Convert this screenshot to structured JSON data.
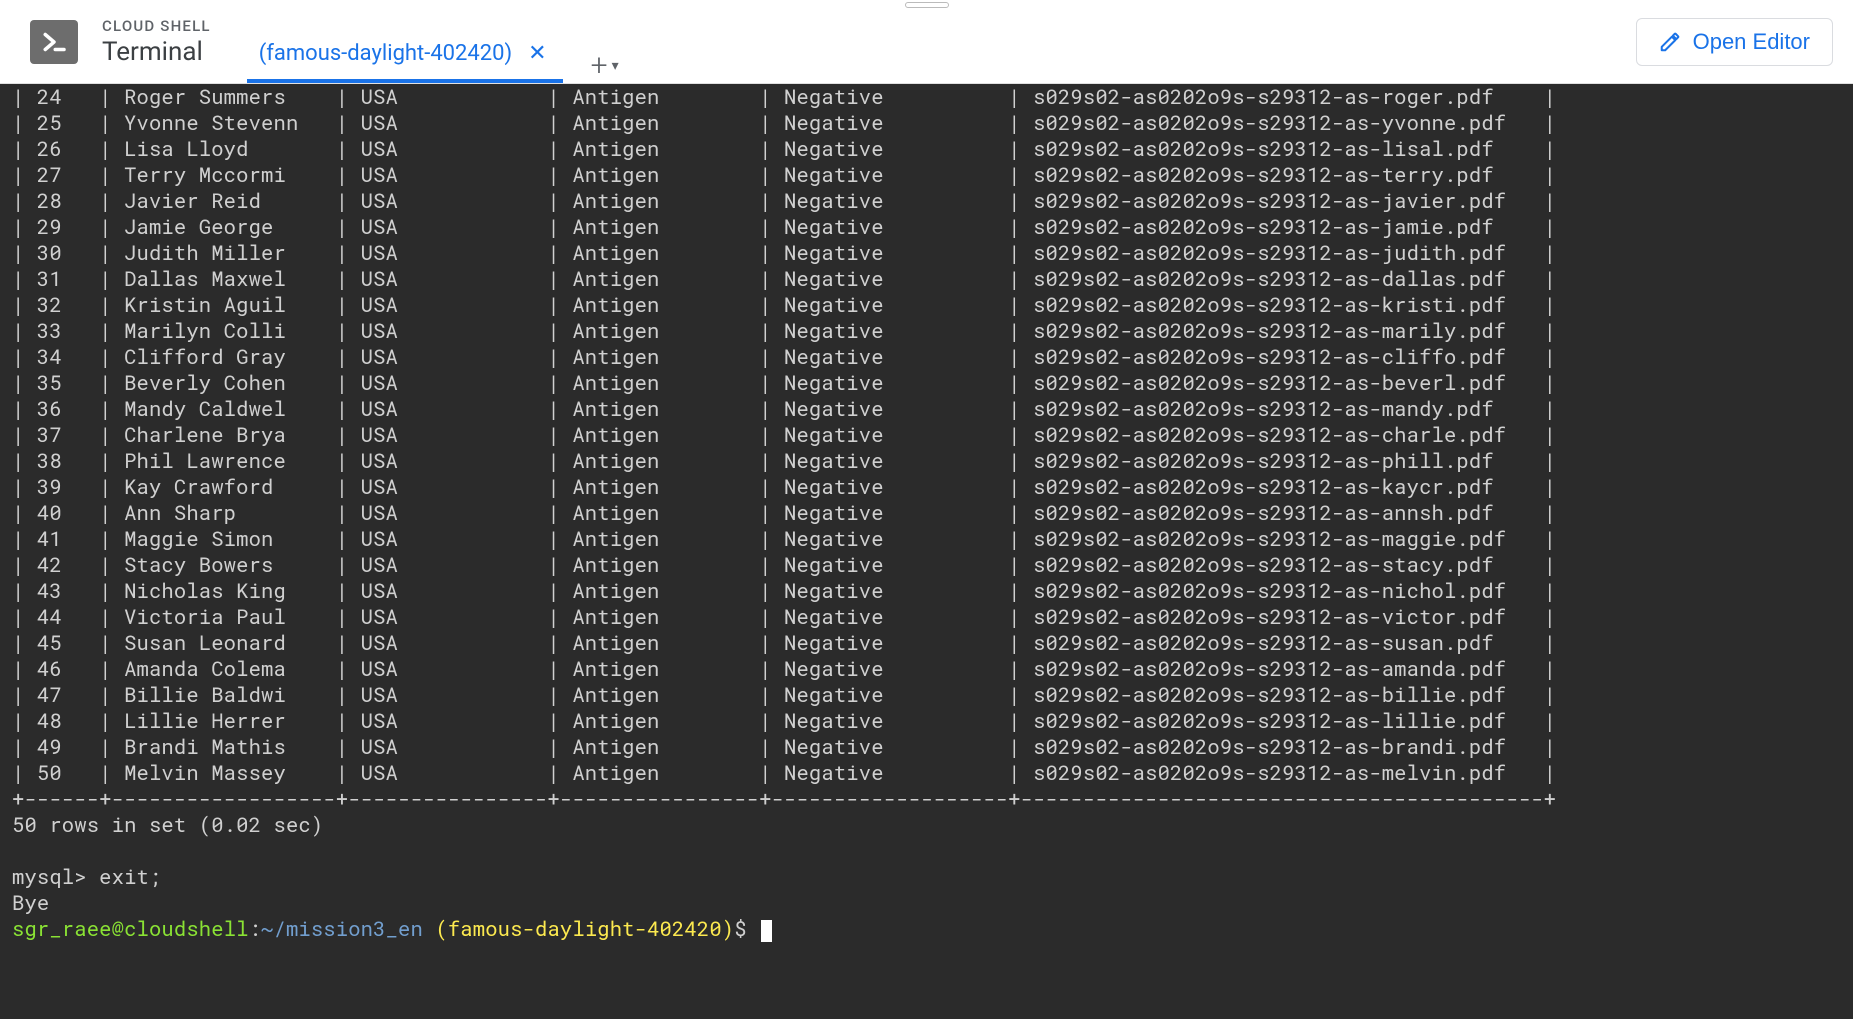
{
  "header": {
    "small_title": "CLOUD SHELL",
    "large_title": "Terminal",
    "active_tab_label": "(famous-daylight-402420)",
    "open_editor_label": "Open Editor"
  },
  "table": {
    "rows": [
      {
        "id": "24",
        "name": "Roger Summers",
        "country": "USA",
        "test": "Antigen",
        "result": "Negative",
        "file": "s029s02-as0202o9s-s29312-as-roger.pdf"
      },
      {
        "id": "25",
        "name": "Yvonne Stevenn",
        "country": "USA",
        "test": "Antigen",
        "result": "Negative",
        "file": "s029s02-as0202o9s-s29312-as-yvonne.pdf"
      },
      {
        "id": "26",
        "name": "Lisa Lloyd",
        "country": "USA",
        "test": "Antigen",
        "result": "Negative",
        "file": "s029s02-as0202o9s-s29312-as-lisal.pdf"
      },
      {
        "id": "27",
        "name": "Terry Mccormi",
        "country": "USA",
        "test": "Antigen",
        "result": "Negative",
        "file": "s029s02-as0202o9s-s29312-as-terry.pdf"
      },
      {
        "id": "28",
        "name": "Javier Reid",
        "country": "USA",
        "test": "Antigen",
        "result": "Negative",
        "file": "s029s02-as0202o9s-s29312-as-javier.pdf"
      },
      {
        "id": "29",
        "name": "Jamie George",
        "country": "USA",
        "test": "Antigen",
        "result": "Negative",
        "file": "s029s02-as0202o9s-s29312-as-jamie.pdf"
      },
      {
        "id": "30",
        "name": "Judith Miller",
        "country": "USA",
        "test": "Antigen",
        "result": "Negative",
        "file": "s029s02-as0202o9s-s29312-as-judith.pdf"
      },
      {
        "id": "31",
        "name": "Dallas Maxwel",
        "country": "USA",
        "test": "Antigen",
        "result": "Negative",
        "file": "s029s02-as0202o9s-s29312-as-dallas.pdf"
      },
      {
        "id": "32",
        "name": "Kristin Aguil",
        "country": "USA",
        "test": "Antigen",
        "result": "Negative",
        "file": "s029s02-as0202o9s-s29312-as-kristi.pdf"
      },
      {
        "id": "33",
        "name": "Marilyn Colli",
        "country": "USA",
        "test": "Antigen",
        "result": "Negative",
        "file": "s029s02-as0202o9s-s29312-as-marily.pdf"
      },
      {
        "id": "34",
        "name": "Clifford Gray",
        "country": "USA",
        "test": "Antigen",
        "result": "Negative",
        "file": "s029s02-as0202o9s-s29312-as-cliffo.pdf"
      },
      {
        "id": "35",
        "name": "Beverly Cohen",
        "country": "USA",
        "test": "Antigen",
        "result": "Negative",
        "file": "s029s02-as0202o9s-s29312-as-beverl.pdf"
      },
      {
        "id": "36",
        "name": "Mandy Caldwel",
        "country": "USA",
        "test": "Antigen",
        "result": "Negative",
        "file": "s029s02-as0202o9s-s29312-as-mandy.pdf"
      },
      {
        "id": "37",
        "name": "Charlene Brya",
        "country": "USA",
        "test": "Antigen",
        "result": "Negative",
        "file": "s029s02-as0202o9s-s29312-as-charle.pdf"
      },
      {
        "id": "38",
        "name": "Phil Lawrence",
        "country": "USA",
        "test": "Antigen",
        "result": "Negative",
        "file": "s029s02-as0202o9s-s29312-as-phill.pdf"
      },
      {
        "id": "39",
        "name": "Kay Crawford",
        "country": "USA",
        "test": "Antigen",
        "result": "Negative",
        "file": "s029s02-as0202o9s-s29312-as-kaycr.pdf"
      },
      {
        "id": "40",
        "name": "Ann Sharp",
        "country": "USA",
        "test": "Antigen",
        "result": "Negative",
        "file": "s029s02-as0202o9s-s29312-as-annsh.pdf"
      },
      {
        "id": "41",
        "name": "Maggie Simon",
        "country": "USA",
        "test": "Antigen",
        "result": "Negative",
        "file": "s029s02-as0202o9s-s29312-as-maggie.pdf"
      },
      {
        "id": "42",
        "name": "Stacy Bowers",
        "country": "USA",
        "test": "Antigen",
        "result": "Negative",
        "file": "s029s02-as0202o9s-s29312-as-stacy.pdf"
      },
      {
        "id": "43",
        "name": "Nicholas King",
        "country": "USA",
        "test": "Antigen",
        "result": "Negative",
        "file": "s029s02-as0202o9s-s29312-as-nichol.pdf"
      },
      {
        "id": "44",
        "name": "Victoria Paul",
        "country": "USA",
        "test": "Antigen",
        "result": "Negative",
        "file": "s029s02-as0202o9s-s29312-as-victor.pdf"
      },
      {
        "id": "45",
        "name": "Susan Leonard",
        "country": "USA",
        "test": "Antigen",
        "result": "Negative",
        "file": "s029s02-as0202o9s-s29312-as-susan.pdf"
      },
      {
        "id": "46",
        "name": "Amanda Colema",
        "country": "USA",
        "test": "Antigen",
        "result": "Negative",
        "file": "s029s02-as0202o9s-s29312-as-amanda.pdf"
      },
      {
        "id": "47",
        "name": "Billie Baldwi",
        "country": "USA",
        "test": "Antigen",
        "result": "Negative",
        "file": "s029s02-as0202o9s-s29312-as-billie.pdf"
      },
      {
        "id": "48",
        "name": "Lillie Herrer",
        "country": "USA",
        "test": "Antigen",
        "result": "Negative",
        "file": "s029s02-as0202o9s-s29312-as-lillie.pdf"
      },
      {
        "id": "49",
        "name": "Brandi Mathis",
        "country": "USA",
        "test": "Antigen",
        "result": "Negative",
        "file": "s029s02-as0202o9s-s29312-as-brandi.pdf"
      },
      {
        "id": "50",
        "name": "Melvin Massey",
        "country": "USA",
        "test": "Antigen",
        "result": "Negative",
        "file": "s029s02-as0202o9s-s29312-as-melvin.pdf"
      }
    ],
    "widths": {
      "id": 4,
      "name": 16,
      "country": 14,
      "test": 14,
      "result": 17,
      "file": 40
    }
  },
  "footer": {
    "summary": "50 rows in set (0.02 sec)",
    "exit_cmd": "mysql> exit;",
    "bye": "Bye",
    "prompt_user": "sgr_raee@cloudshell",
    "prompt_colon": ":",
    "prompt_path": "~/mission3_en",
    "prompt_project": "(famous-daylight-402420)",
    "prompt_dollar": "$"
  }
}
